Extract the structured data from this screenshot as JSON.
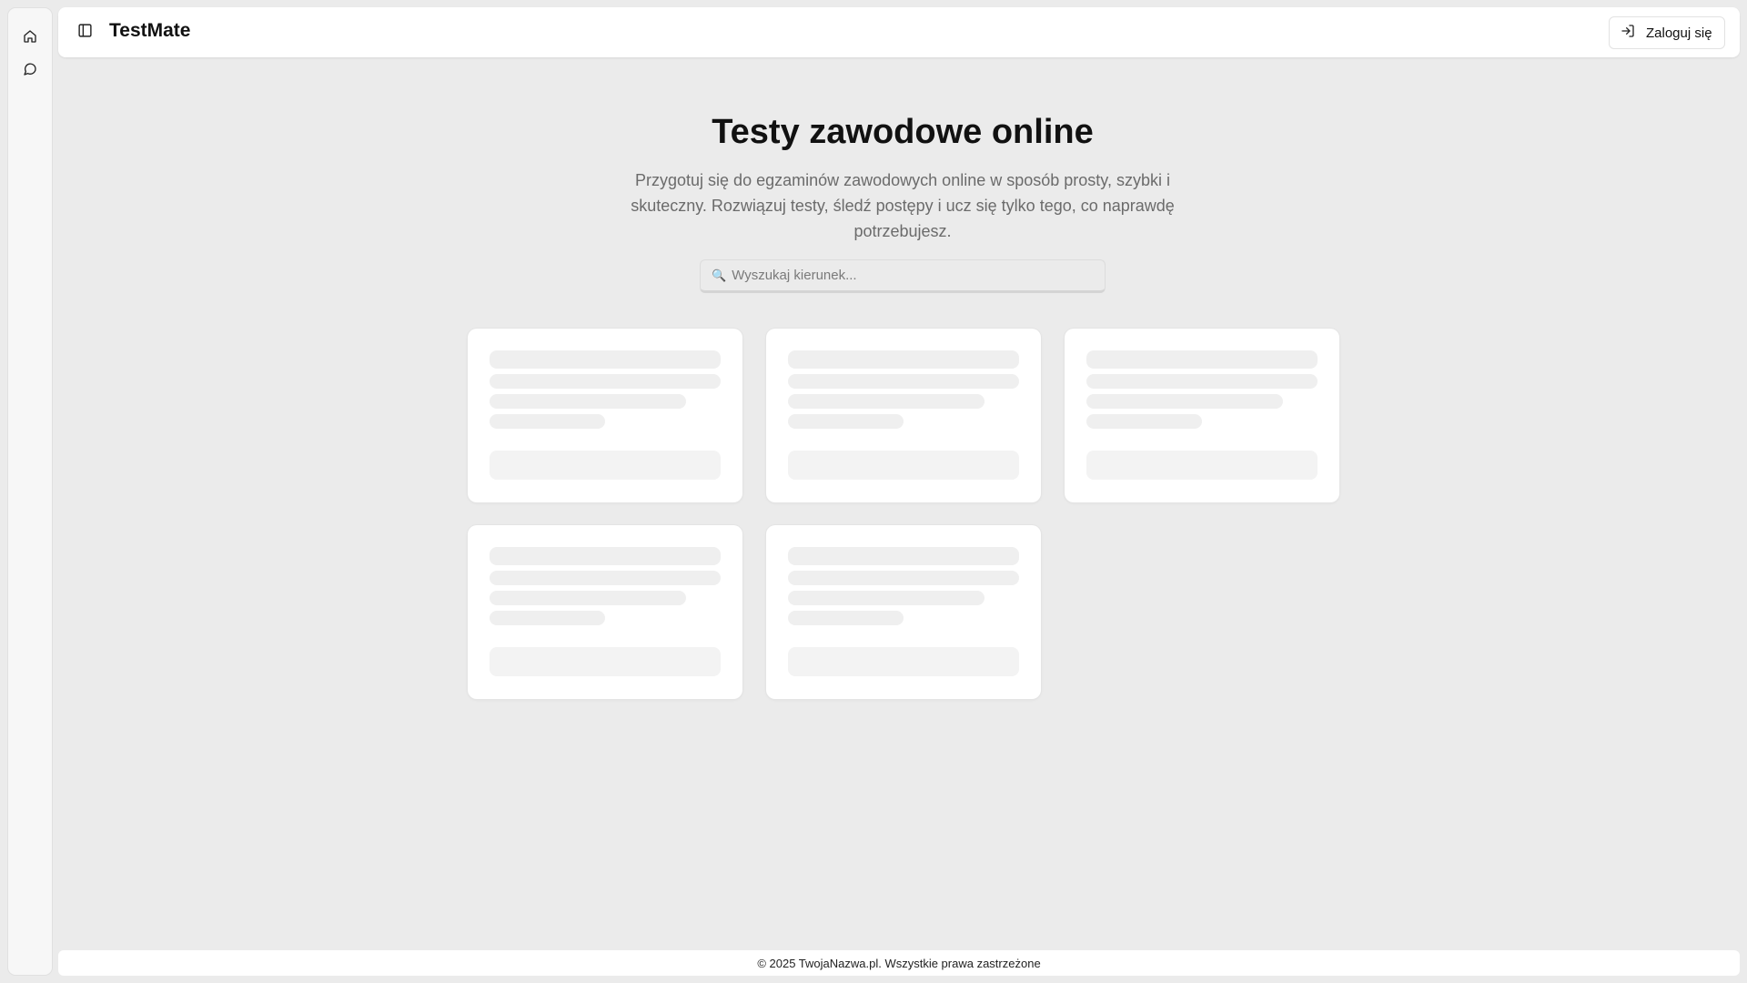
{
  "rail": {
    "items": [
      {
        "icon": "home-icon",
        "label": "Home"
      },
      {
        "icon": "chat-icon",
        "label": "Chat"
      }
    ]
  },
  "header": {
    "app_title": "TestMate",
    "login_label": "Zaloguj się"
  },
  "hero": {
    "title": "Testy zawodowe online",
    "subtitle": "Przygotuj się do egzaminów zawodowych online w sposób prosty, szybki i skuteczny. Rozwiązuj testy, śledź postępy i ucz się tylko tego, co naprawdę potrzebujesz."
  },
  "search": {
    "icon": "🔍",
    "placeholder": "Wyszukaj kierunek..."
  },
  "cards": {
    "state": "loading",
    "count": 5
  },
  "footer": {
    "text": "© 2025 TwojaNazwa.pl. Wszystkie prawa zastrzeżone"
  },
  "colors": {
    "background": "#ebebeb",
    "surface": "#ffffff",
    "skeleton": "#efefef",
    "muted_text": "#6b6b6b"
  }
}
